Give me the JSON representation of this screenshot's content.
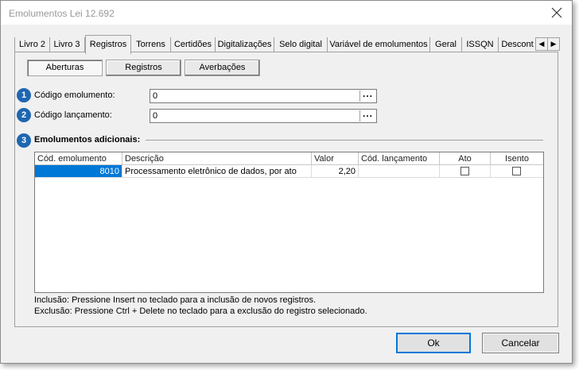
{
  "window": {
    "title": "Emolumentos Lei 12.692"
  },
  "tabs": [
    {
      "label": "Livro 2"
    },
    {
      "label": "Livro 3"
    },
    {
      "label": "Registros"
    },
    {
      "label": "Torrens"
    },
    {
      "label": "Certidões"
    },
    {
      "label": "Digitalizações"
    },
    {
      "label": "Selo digital"
    },
    {
      "label": "Variável de emolumentos"
    },
    {
      "label": "Geral"
    },
    {
      "label": "ISSQN"
    },
    {
      "label": "Descont"
    }
  ],
  "active_tab": "Registros",
  "subtabs": [
    {
      "label": "Aberturas"
    },
    {
      "label": "Registros"
    },
    {
      "label": "Averbações"
    }
  ],
  "form": {
    "codigo_emolumento": {
      "step": "1",
      "label": "Código emolumento:",
      "value": "0"
    },
    "codigo_lancamento": {
      "step": "2",
      "label": "Código lançamento:",
      "value": "0"
    },
    "adicionais": {
      "step": "3",
      "label": "Emolumentos adicionais:"
    }
  },
  "grid": {
    "headers": [
      "Cód. emolumento",
      "Descrição",
      "Valor",
      "Cód. lançamento",
      "Ato",
      "Isento"
    ],
    "rows": [
      {
        "cod_emolumento": "8010",
        "descricao": "Processamento eletrônico de dados, por ato",
        "valor": "2,20",
        "cod_lancamento": "",
        "ato": false,
        "isento": false
      }
    ]
  },
  "info": {
    "inclusao": "Inclusão: Pressione Insert no teclado para a inclusão de novos registros.",
    "exclusao": "Exclusão: Pressione Ctrl + Delete no teclado para a exclusão do registro selecionado."
  },
  "buttons": {
    "ok_label": "Ok",
    "cancel_label": "Cancelar"
  },
  "icons": {
    "close": "close-icon",
    "scroll_left": "chevron-left-icon",
    "scroll_right": "chevron-right-icon",
    "lookup": "ellipsis-icon"
  },
  "colors": {
    "accent": "#1f66b1",
    "selection": "#0078d7"
  }
}
